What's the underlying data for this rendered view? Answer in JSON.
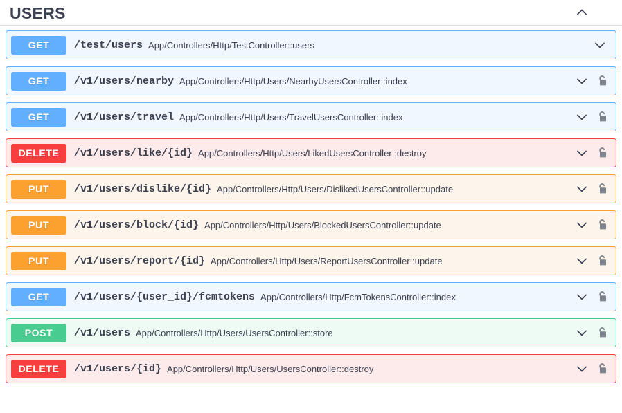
{
  "section": {
    "title": "USERS",
    "collapse_icon": "chevron-up-icon",
    "expanded": true
  },
  "icons": {
    "expand": "chevron-down-icon",
    "collapse": "chevron-up-icon",
    "auth": "unlocked-padlock-icon"
  },
  "colors": {
    "get": "#61affe",
    "post": "#49cc90",
    "put": "#fca130",
    "delete": "#f93e3e",
    "get_bg": "#eff7ff",
    "post_bg": "#eefaf4",
    "put_bg": "#fdf4eb",
    "delete_bg": "#fdeaea",
    "text": "#3b4151",
    "lock": "#7c838c"
  },
  "operations": [
    {
      "method": "GET",
      "method_class": "get",
      "path": "/test/users",
      "summary": "App/Controllers/Http/TestController::users",
      "locked": false
    },
    {
      "method": "GET",
      "method_class": "get",
      "path": "/v1/users/nearby",
      "summary": "App/Controllers/Http/Users/NearbyUsersController::index",
      "locked": true
    },
    {
      "method": "GET",
      "method_class": "get",
      "path": "/v1/users/travel",
      "summary": "App/Controllers/Http/Users/TravelUsersController::index",
      "locked": true
    },
    {
      "method": "DELETE",
      "method_class": "delete",
      "path": "/v1/users/like/{id}",
      "summary": "App/Controllers/Http/Users/LikedUsersController::destroy",
      "locked": true
    },
    {
      "method": "PUT",
      "method_class": "put",
      "path": "/v1/users/dislike/{id}",
      "summary": "App/Controllers/Http/Users/DislikedUsersController::update",
      "locked": true
    },
    {
      "method": "PUT",
      "method_class": "put",
      "path": "/v1/users/block/{id}",
      "summary": "App/Controllers/Http/Users/BlockedUsersController::update",
      "locked": true
    },
    {
      "method": "PUT",
      "method_class": "put",
      "path": "/v1/users/report/{id}",
      "summary": "App/Controllers/Http/Users/ReportUsersController::update",
      "locked": true
    },
    {
      "method": "GET",
      "method_class": "get",
      "path": "/v1/users/{user_id}/fcmtokens",
      "summary": "App/Controllers/Http/FcmTokensController::index",
      "locked": true
    },
    {
      "method": "POST",
      "method_class": "post",
      "path": "/v1/users",
      "summary": "App/Controllers/Http/Users/UsersController::store",
      "locked": true
    },
    {
      "method": "DELETE",
      "method_class": "delete",
      "path": "/v1/users/{id}",
      "summary": "App/Controllers/Http/Users/UsersController::destroy",
      "locked": true
    }
  ]
}
